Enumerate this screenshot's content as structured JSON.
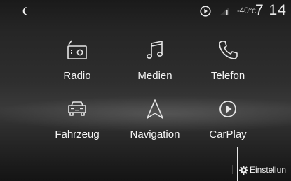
{
  "status": {
    "temperature": "-40°c",
    "clock": "7 14"
  },
  "menu": {
    "tiles": [
      {
        "label": "Radio",
        "icon": "radio-icon"
      },
      {
        "label": "Medien",
        "icon": "music-note-icon"
      },
      {
        "label": "Telefon",
        "icon": "phone-icon"
      },
      {
        "label": "Fahrzeug",
        "icon": "car-icon"
      },
      {
        "label": "Navigation",
        "icon": "navigation-arrow-icon"
      },
      {
        "label": "CarPlay",
        "icon": "carplay-icon"
      }
    ]
  },
  "bottom": {
    "settings_label": "Einstellun"
  },
  "colors": {
    "background": "#2a2a2a",
    "text": "#f5f5f5",
    "icon": "#e6e6e6"
  }
}
